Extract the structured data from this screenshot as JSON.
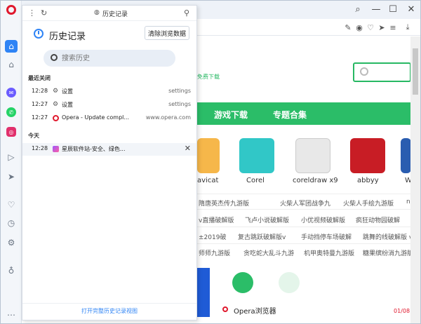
{
  "browser": {
    "address_icons": [
      "edit-icon",
      "camera-icon",
      "heart-icon",
      "send-icon",
      "menu-icon",
      "download-icon"
    ]
  },
  "history_panel": {
    "top_title": "历史记录",
    "title": "历史记录",
    "clear_button": "清除浏览数据",
    "search_placeholder": "搜索历史",
    "recently_closed_label": "最近关闭",
    "today_label": "今天",
    "recently_closed": [
      {
        "time": "12:28",
        "icon": "gear-icon",
        "title": "设置",
        "domain": "settings"
      },
      {
        "time": "12:27",
        "icon": "gear-icon",
        "title": "设置",
        "domain": "settings"
      },
      {
        "time": "12:27",
        "icon": "opera-icon",
        "title": "Opera - Update compl...",
        "domain": "www.opera.com"
      }
    ],
    "today": [
      {
        "time": "12:28",
        "icon": "site-icon",
        "title": "星辰软件站-安全、绿色...",
        "domain": ""
      }
    ],
    "footer_link": "打开完整历史记录视图"
  },
  "webpage": {
    "slogan": "免费下载",
    "nav": [
      "游戏下载",
      "专题合集"
    ],
    "apps": [
      "avicat",
      "Corel",
      "coreldraw x9",
      "abbyy",
      "W"
    ],
    "tag_rows": [
      [
        "隋唐英杰传九游版",
        "火柴人军团战争九",
        "火柴人手绘九游版",
        "na"
      ],
      [
        "v直播破解版",
        "飞卢小说破解版",
        "小优视频破解版",
        "疯狂动物园破解"
      ],
      [
        "±2019破",
        "复古跳跃破解版v",
        "手动挡停车场破解",
        "跳舞的线破解版 v"
      ],
      [
        "师师九游版",
        "贪吃蛇大乱斗九游",
        "机甲奥特曼九游版",
        "糖果缤纷消九游版"
      ]
    ],
    "bottom_label": "Opera浏览器",
    "page_count": "01/08"
  },
  "colors": {
    "accent": "#2f84f5",
    "opera_red": "#e0182d",
    "site_green": "#2bbd68"
  }
}
